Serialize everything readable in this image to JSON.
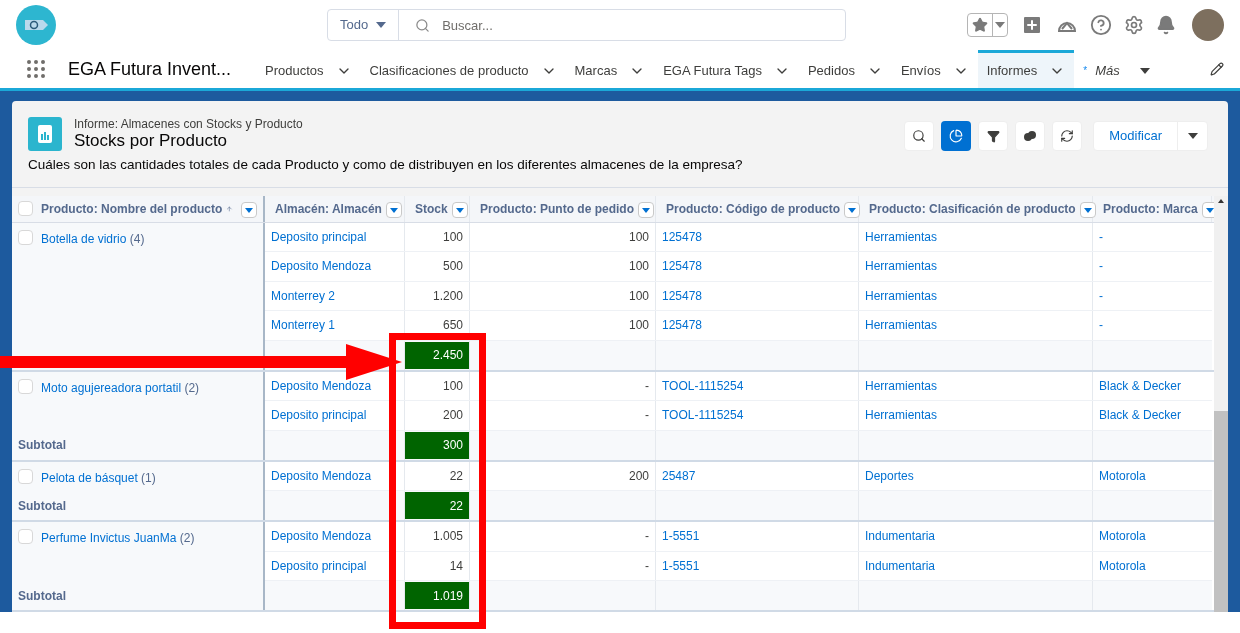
{
  "search": {
    "scope": "Todo",
    "placeholder": "Buscar..."
  },
  "app": {
    "name": "EGA Futura Invent..."
  },
  "nav": [
    {
      "kind": "menu",
      "label": "Productos",
      "selected": false
    },
    {
      "kind": "menu",
      "label": "Clasificaciones de producto",
      "selected": false
    },
    {
      "kind": "menu",
      "label": "Marcas",
      "selected": false
    },
    {
      "kind": "menu",
      "label": "EGA Futura Tags",
      "selected": false
    },
    {
      "kind": "menu",
      "label": "Pedidos",
      "selected": false
    },
    {
      "kind": "menu",
      "label": "Envíos",
      "selected": false
    },
    {
      "kind": "menu",
      "label": "Informes",
      "selected": true
    },
    {
      "kind": "more",
      "prefix": "*",
      "label": "Más",
      "selected": false
    }
  ],
  "report": {
    "type_label": "Informe: Almacenes con Stocks y Producto",
    "title": "Stocks por Producto",
    "description": "Cuáles son las cantidades totales de cada Producto y como de distribuyen en los diferentes almacenes de la empresa?",
    "chart_toggle_on": true,
    "edit_button": "Modificar"
  },
  "table": {
    "all_checked": false,
    "columns": [
      "Producto: Nombre del producto",
      "Almacén: Almacén",
      "Stock",
      "Producto: Punto de pedido",
      "Producto: Código de producto",
      "Producto: Clasificación de producto",
      "Producto: Marca"
    ],
    "groups": [
      {
        "product": "Botella de vidrio",
        "count": "(4)",
        "checked": false,
        "subtotal": "2.450",
        "highlighted": true,
        "rows": [
          {
            "almacen": "Deposito principal",
            "stock": "100",
            "punto": "100",
            "codigo": "125478",
            "clasificacion": "Herramientas",
            "marca": "-"
          },
          {
            "almacen": "Deposito Mendoza",
            "stock": "500",
            "punto": "100",
            "codigo": "125478",
            "clasificacion": "Herramientas",
            "marca": "-"
          },
          {
            "almacen": "Monterrey 2",
            "stock": "1.200",
            "punto": "100",
            "codigo": "125478",
            "clasificacion": "Herramientas",
            "marca": "-"
          },
          {
            "almacen": "Monterrey 1",
            "stock": "650",
            "punto": "100",
            "codigo": "125478",
            "clasificacion": "Herramientas",
            "marca": "-"
          }
        ]
      },
      {
        "product": "Moto agujereadora portatil",
        "count": "(2)",
        "checked": false,
        "subtotal_label": "Subtotal",
        "subtotal": "300",
        "highlighted": true,
        "rows": [
          {
            "almacen": "Deposito Mendoza",
            "stock": "100",
            "punto": "-",
            "codigo": "TOOL-1115254",
            "clasificacion": "Herramientas",
            "marca": "Black & Decker"
          },
          {
            "almacen": "Deposito principal",
            "stock": "200",
            "punto": "-",
            "codigo": "TOOL-1115254",
            "clasificacion": "Herramientas",
            "marca": "Black & Decker"
          }
        ]
      },
      {
        "product": "Pelota de básquet",
        "count": "(1)",
        "checked": false,
        "subtotal_label": "Subtotal",
        "subtotal": "22",
        "highlighted": true,
        "rows": [
          {
            "almacen": "Deposito Mendoza",
            "stock": "22",
            "punto": "200",
            "codigo": "25487",
            "clasificacion": "Deportes",
            "marca": "Motorola"
          }
        ]
      },
      {
        "product": "Perfume Invictus JuanMa",
        "count": "(2)",
        "checked": false,
        "subtotal_label": "Subtotal",
        "subtotal": "1.019",
        "highlighted": true,
        "rows": [
          {
            "almacen": "Deposito Mendoza",
            "stock": "1.005",
            "punto": "-",
            "codigo": "1-5551",
            "clasificacion": "Indumentaria",
            "marca": "Motorola"
          },
          {
            "almacen": "Deposito principal",
            "stock": "14",
            "punto": "-",
            "codigo": "1-5551",
            "clasificacion": "Indumentaria",
            "marca": "Motorola"
          }
        ]
      }
    ]
  }
}
